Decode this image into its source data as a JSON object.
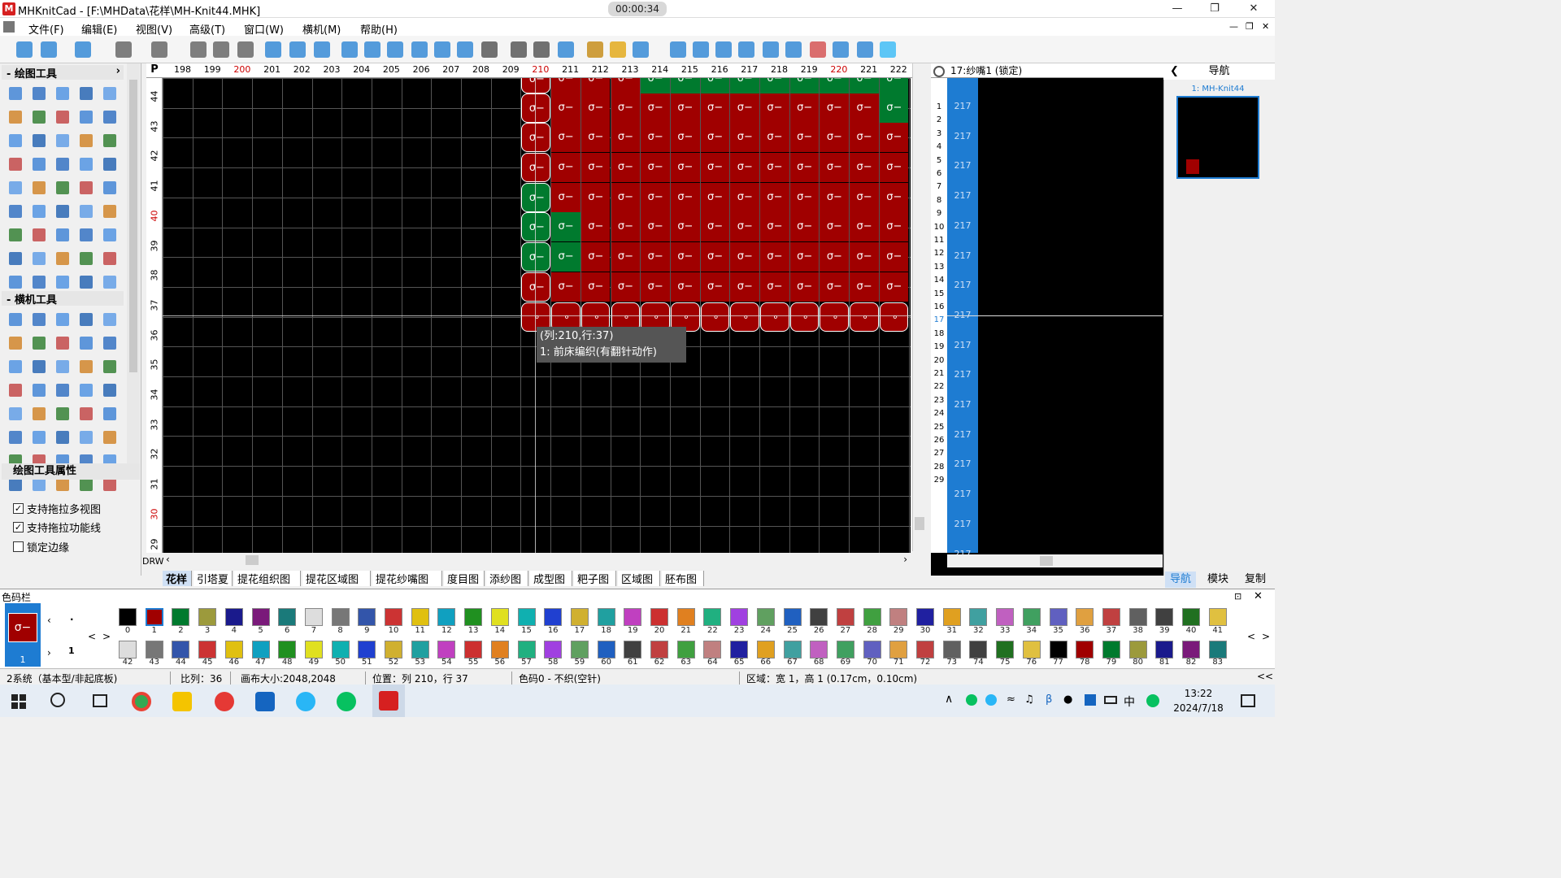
{
  "app": {
    "title": "MHKnitCad - [F:\\MHData\\花样\\MH-Knit44.MHK]",
    "timer": "00:00:34",
    "min_icon": "minimize-icon",
    "max_icon": "restore-icon",
    "close_icon": "close-icon"
  },
  "menu": [
    "文件(F)",
    "编辑(E)",
    "视图(V)",
    "高级(T)",
    "窗口(W)",
    "横机(M)",
    "帮助(H)"
  ],
  "left_panel": {
    "drawing_tools": "绘图工具",
    "knit_tools": "横机工具",
    "tool_props": "绘图工具属性",
    "options": [
      {
        "label": "支持拖拉多视图",
        "checked": true
      },
      {
        "label": "支持拖拉功能线",
        "checked": true
      },
      {
        "label": "锁定边缘",
        "checked": false
      }
    ]
  },
  "ruler": {
    "corner": "P",
    "cols": [
      "198",
      "199",
      "200",
      "201",
      "202",
      "203",
      "204",
      "205",
      "206",
      "207",
      "208",
      "209",
      "210",
      "211",
      "212",
      "213",
      "214",
      "215",
      "216",
      "217",
      "218",
      "219",
      "220",
      "221",
      "222"
    ],
    "rows": [
      "44",
      "43",
      "42",
      "41",
      "40",
      "39",
      "38",
      "37",
      "36",
      "35",
      "34",
      "33",
      "32",
      "31",
      "30",
      "29"
    ]
  },
  "tooltip": {
    "line1": "(列:210,行:37)",
    "line2": "1: 前床编织(有翻针动作)"
  },
  "drw": "DRW",
  "sheet_tabs": [
    "花样",
    "引塔夏",
    "提花组织图",
    "提花区域图",
    "提花纱嘴图",
    "度目图",
    "添纱图",
    "成型图",
    "粑子图",
    "区域图",
    "胚布图"
  ],
  "yarn": {
    "header": "17:纱嘴1 (锁定)",
    "rows": [
      "1",
      "2",
      "3",
      "4",
      "5",
      "6",
      "7",
      "8",
      "9",
      "10",
      "11",
      "12",
      "13",
      "14",
      "15",
      "16",
      "17",
      "18",
      "19",
      "20",
      "21",
      "22",
      "23",
      "24",
      "25",
      "26",
      "27",
      "28",
      "29"
    ],
    "value": "217"
  },
  "nav": {
    "title": "导航",
    "label": "1: MH-Knit44",
    "tabs": [
      "导航",
      "模块",
      "复制"
    ]
  },
  "colorbar": {
    "title": "色码栏",
    "selected": "1",
    "dot": ".",
    "row2": "1",
    "row1": [
      "0",
      "1",
      "2",
      "3",
      "4",
      "5",
      "6",
      "7",
      "8",
      "9",
      "10",
      "11",
      "12",
      "13",
      "14",
      "15",
      "16",
      "17",
      "18",
      "19",
      "20",
      "21",
      "22",
      "23",
      "24",
      "25",
      "26",
      "27",
      "28",
      "29",
      "30",
      "31",
      "32",
      "33",
      "34",
      "35",
      "36",
      "37",
      "38",
      "39",
      "40",
      "41"
    ],
    "row2_nums": [
      "42",
      "43",
      "44",
      "45",
      "46",
      "47",
      "48",
      "49",
      "50",
      "51",
      "52",
      "53",
      "54",
      "55",
      "56",
      "57",
      "58",
      "59",
      "60",
      "61",
      "62",
      "63",
      "64",
      "65",
      "66",
      "67",
      "68",
      "69",
      "70",
      "71",
      "72",
      "73",
      "74",
      "75",
      "76",
      "77",
      "78",
      "79",
      "80",
      "81",
      "82",
      "83"
    ],
    "palette": [
      "#000000",
      "#a00000",
      "#007a2e",
      "#9c9a3c",
      "#1a1a8c",
      "#7a1a7a",
      "#1a7a7a",
      "#dddddd",
      "#777777",
      "#3355aa",
      "#cc3333",
      "#e0c010",
      "#10a0c0",
      "#209020",
      "#e0e020",
      "#10b0b0",
      "#2040d0",
      "#d0b030",
      "#20a0a0",
      "#c040c0",
      "#cc3030",
      "#e08020",
      "#20b080",
      "#a040e0",
      "#60a060",
      "#2060c0",
      "#404040",
      "#c04040",
      "#40a040",
      "#c08080",
      "#2020a0",
      "#e0a020",
      "#40a0a0",
      "#c060c0",
      "#40a060",
      "#6060c0",
      "#e0a040",
      "#c04040",
      "#606060",
      "#404040",
      "#207020",
      "#e0c040"
    ]
  },
  "status": {
    "system": "2系统（基本型/非起底板)",
    "scale": "比列：36",
    "canvas": "画布大小:2048,2048",
    "position": "位置：列  210，行  37",
    "color": "色码0 - 不织(空针)",
    "region": "区域：宽 1，高  1 (0.17cm，0.10cm)"
  },
  "taskbar": {
    "time": "13:22",
    "date": "2024/7/18",
    "ime": "中"
  }
}
